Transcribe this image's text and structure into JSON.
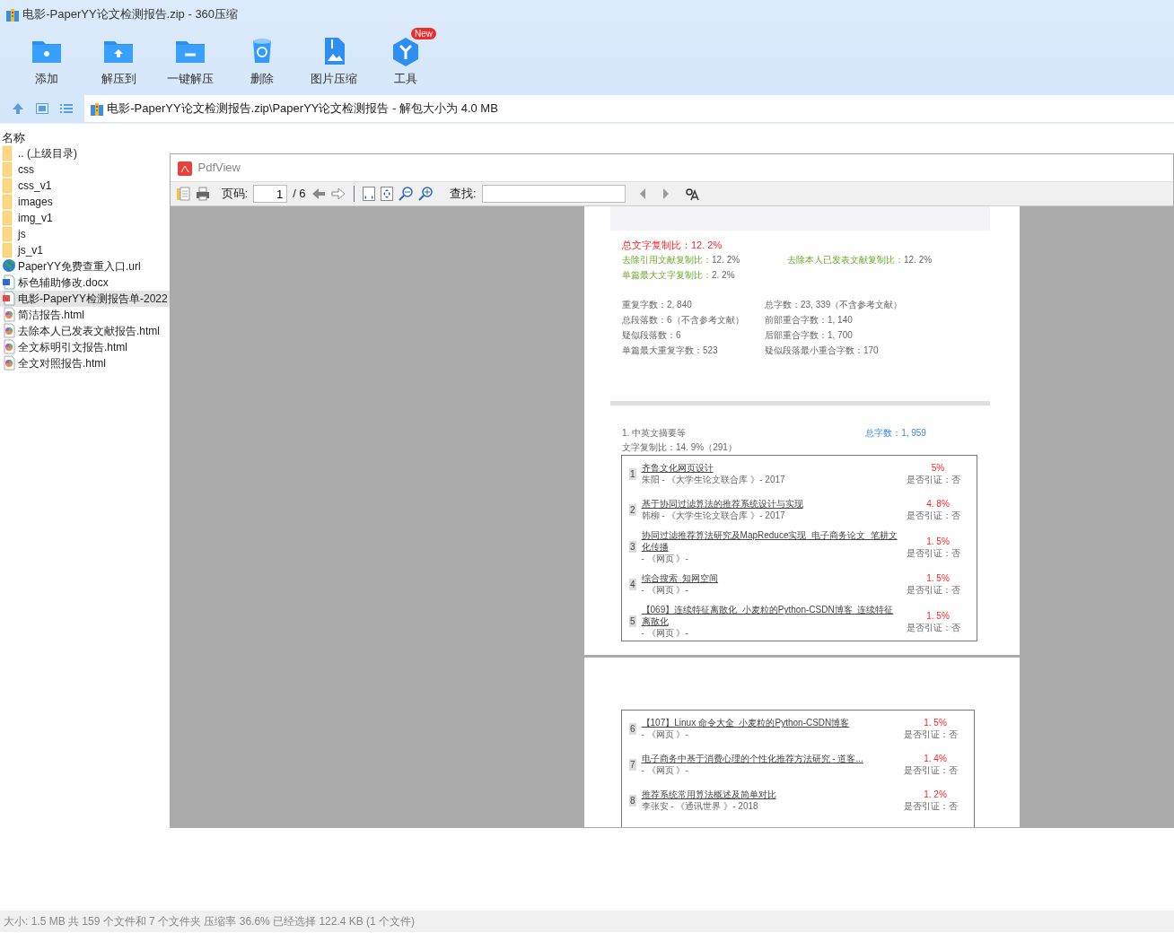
{
  "window": {
    "title": "电影-PaperYY论文检测报告.zip - 360压缩"
  },
  "toolbar": [
    {
      "label": "添加",
      "kind": "add"
    },
    {
      "label": "解压到",
      "kind": "extract"
    },
    {
      "label": "一键解压",
      "kind": "oneclick"
    },
    {
      "label": "删除",
      "kind": "delete"
    },
    {
      "label": "图片压缩",
      "kind": "image"
    },
    {
      "label": "工具",
      "kind": "tools",
      "badge": "New"
    }
  ],
  "address": {
    "path": "电影-PaperYY论文检测报告.zip\\PaperYY论文检测报告 - 解包大小为 4.0 MB"
  },
  "file_list": {
    "column": "名称",
    "items": [
      {
        "name": ".. (上级目录)",
        "kind": "folder",
        "selected": false
      },
      {
        "name": "css",
        "kind": "folder",
        "selected": false
      },
      {
        "name": "css_v1",
        "kind": "folder",
        "selected": false
      },
      {
        "name": "images",
        "kind": "folder",
        "selected": false
      },
      {
        "name": "img_v1",
        "kind": "folder",
        "selected": false
      },
      {
        "name": "js",
        "kind": "folder",
        "selected": false
      },
      {
        "name": "js_v1",
        "kind": "folder",
        "selected": false
      },
      {
        "name": "PaperYY免费查重入口.url",
        "kind": "url",
        "selected": false
      },
      {
        "name": "标色辅助修改.docx",
        "kind": "docx",
        "selected": false
      },
      {
        "name": "电影-PaperYY检测报告单-2022",
        "kind": "pdf",
        "selected": true
      },
      {
        "name": "简洁报告.html",
        "kind": "html",
        "selected": false
      },
      {
        "name": "去除本人已发表文献报告.html",
        "kind": "html",
        "selected": false
      },
      {
        "name": "全文标明引文报告.html",
        "kind": "html",
        "selected": false
      },
      {
        "name": "全文对照报告.html",
        "kind": "html",
        "selected": false
      }
    ]
  },
  "pdf_viewer": {
    "title": "PdfView",
    "page_label": "页码:",
    "page": "1",
    "page_total": "/ 6",
    "find_label": "查找:",
    "report": {
      "total": "总文字复制比：12. 2%",
      "ratios": [
        {
          "label": "去除引用文献复制比：",
          "value": "12. 2%"
        },
        {
          "label": "去除本人已发表文献复制比：",
          "value": "12. 2%"
        },
        {
          "label": "单篇最大文字复制比：",
          "value": "2. 2%"
        }
      ],
      "stats": [
        "重复字数：2, 840",
        "总字数：23, 339（不含参考文献）",
        "总段落数：6（不含参考文献）",
        "前部重合字数：1, 140",
        "疑似段落数：6",
        "后部重合字数：1, 700",
        "单篇最大重复字数：523",
        "疑似段落最小重合字数：170"
      ],
      "section": {
        "title": "1. 中英文摘要等",
        "word_count": "总字数：1, 959",
        "ratio": "文字复制比：14. 9%（291）"
      },
      "sources": [
        {
          "no": "1",
          "title": "齐鲁文化网页设计",
          "meta": "朱阳 - 《大学生论文联合库 》- 2017",
          "pct": "5%",
          "cited": "是否引证：否"
        },
        {
          "no": "2",
          "title": "基于协同过滤算法的推荐系统设计与实现",
          "meta": "韩柳 - 《大学生论文联合库 》- 2017",
          "pct": "4. 8%",
          "cited": "是否引证：否"
        },
        {
          "no": "3",
          "title": "协同过滤推荐算法研究及MapReduce实现_电子商务论文_笔耕文化传播",
          "meta": "- 《网页 》-",
          "pct": "1. 5%",
          "cited": "是否引证：否"
        },
        {
          "no": "4",
          "title": "综合搜索_知网空间",
          "meta": "- 《网页 》-",
          "pct": "1. 5%",
          "cited": "是否引证：否"
        },
        {
          "no": "5",
          "title": "【069】连续特征离散化_小麦粒的Python-CSDN博客_连续特征离散化",
          "meta": "- 《网页 》-",
          "pct": "1. 5%",
          "cited": "是否引证：否"
        }
      ],
      "page2_sources": [
        {
          "no": "6",
          "title": "【107】Linux 命令大全_小麦粒的Python-CSDN博客",
          "meta": "- 《网页 》-",
          "pct": "1. 5%",
          "cited": "是否引证：否"
        },
        {
          "no": "7",
          "title": "电子商务中基于消费心理的个性化推荐方法研究 - 道客...",
          "meta": "- 《网页 》-",
          "pct": "1. 4%",
          "cited": "是否引证：否"
        },
        {
          "no": "8",
          "title": "推荐系统常用算法概述及简单对比",
          "meta": "李张安 - 《通讯世界 》- 2018",
          "pct": "1. 2%",
          "cited": "是否引证：否"
        }
      ]
    }
  },
  "status_bar": "大小: 1.5 MB 共 159 个文件和 7 个文件夹 压缩率 36.6% 已经选择 122.4 KB (1 个文件)"
}
